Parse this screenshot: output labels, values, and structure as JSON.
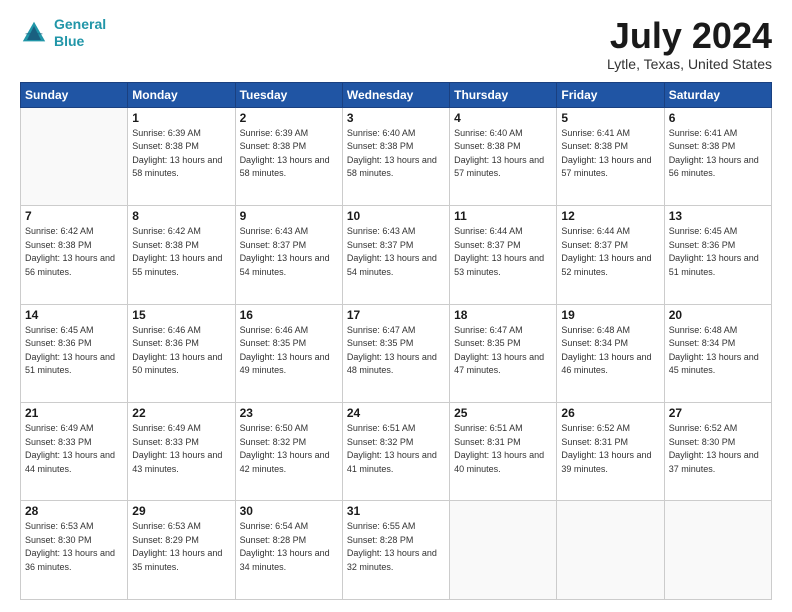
{
  "header": {
    "logo_line1": "General",
    "logo_line2": "Blue",
    "title": "July 2024",
    "location": "Lytle, Texas, United States"
  },
  "days_of_week": [
    "Sunday",
    "Monday",
    "Tuesday",
    "Wednesday",
    "Thursday",
    "Friday",
    "Saturday"
  ],
  "weeks": [
    [
      {
        "day": "",
        "sunrise": "",
        "sunset": "",
        "daylight": ""
      },
      {
        "day": "1",
        "sunrise": "Sunrise: 6:39 AM",
        "sunset": "Sunset: 8:38 PM",
        "daylight": "Daylight: 13 hours and 58 minutes."
      },
      {
        "day": "2",
        "sunrise": "Sunrise: 6:39 AM",
        "sunset": "Sunset: 8:38 PM",
        "daylight": "Daylight: 13 hours and 58 minutes."
      },
      {
        "day": "3",
        "sunrise": "Sunrise: 6:40 AM",
        "sunset": "Sunset: 8:38 PM",
        "daylight": "Daylight: 13 hours and 58 minutes."
      },
      {
        "day": "4",
        "sunrise": "Sunrise: 6:40 AM",
        "sunset": "Sunset: 8:38 PM",
        "daylight": "Daylight: 13 hours and 57 minutes."
      },
      {
        "day": "5",
        "sunrise": "Sunrise: 6:41 AM",
        "sunset": "Sunset: 8:38 PM",
        "daylight": "Daylight: 13 hours and 57 minutes."
      },
      {
        "day": "6",
        "sunrise": "Sunrise: 6:41 AM",
        "sunset": "Sunset: 8:38 PM",
        "daylight": "Daylight: 13 hours and 56 minutes."
      }
    ],
    [
      {
        "day": "7",
        "sunrise": "Sunrise: 6:42 AM",
        "sunset": "Sunset: 8:38 PM",
        "daylight": "Daylight: 13 hours and 56 minutes."
      },
      {
        "day": "8",
        "sunrise": "Sunrise: 6:42 AM",
        "sunset": "Sunset: 8:38 PM",
        "daylight": "Daylight: 13 hours and 55 minutes."
      },
      {
        "day": "9",
        "sunrise": "Sunrise: 6:43 AM",
        "sunset": "Sunset: 8:37 PM",
        "daylight": "Daylight: 13 hours and 54 minutes."
      },
      {
        "day": "10",
        "sunrise": "Sunrise: 6:43 AM",
        "sunset": "Sunset: 8:37 PM",
        "daylight": "Daylight: 13 hours and 54 minutes."
      },
      {
        "day": "11",
        "sunrise": "Sunrise: 6:44 AM",
        "sunset": "Sunset: 8:37 PM",
        "daylight": "Daylight: 13 hours and 53 minutes."
      },
      {
        "day": "12",
        "sunrise": "Sunrise: 6:44 AM",
        "sunset": "Sunset: 8:37 PM",
        "daylight": "Daylight: 13 hours and 52 minutes."
      },
      {
        "day": "13",
        "sunrise": "Sunrise: 6:45 AM",
        "sunset": "Sunset: 8:36 PM",
        "daylight": "Daylight: 13 hours and 51 minutes."
      }
    ],
    [
      {
        "day": "14",
        "sunrise": "Sunrise: 6:45 AM",
        "sunset": "Sunset: 8:36 PM",
        "daylight": "Daylight: 13 hours and 51 minutes."
      },
      {
        "day": "15",
        "sunrise": "Sunrise: 6:46 AM",
        "sunset": "Sunset: 8:36 PM",
        "daylight": "Daylight: 13 hours and 50 minutes."
      },
      {
        "day": "16",
        "sunrise": "Sunrise: 6:46 AM",
        "sunset": "Sunset: 8:35 PM",
        "daylight": "Daylight: 13 hours and 49 minutes."
      },
      {
        "day": "17",
        "sunrise": "Sunrise: 6:47 AM",
        "sunset": "Sunset: 8:35 PM",
        "daylight": "Daylight: 13 hours and 48 minutes."
      },
      {
        "day": "18",
        "sunrise": "Sunrise: 6:47 AM",
        "sunset": "Sunset: 8:35 PM",
        "daylight": "Daylight: 13 hours and 47 minutes."
      },
      {
        "day": "19",
        "sunrise": "Sunrise: 6:48 AM",
        "sunset": "Sunset: 8:34 PM",
        "daylight": "Daylight: 13 hours and 46 minutes."
      },
      {
        "day": "20",
        "sunrise": "Sunrise: 6:48 AM",
        "sunset": "Sunset: 8:34 PM",
        "daylight": "Daylight: 13 hours and 45 minutes."
      }
    ],
    [
      {
        "day": "21",
        "sunrise": "Sunrise: 6:49 AM",
        "sunset": "Sunset: 8:33 PM",
        "daylight": "Daylight: 13 hours and 44 minutes."
      },
      {
        "day": "22",
        "sunrise": "Sunrise: 6:49 AM",
        "sunset": "Sunset: 8:33 PM",
        "daylight": "Daylight: 13 hours and 43 minutes."
      },
      {
        "day": "23",
        "sunrise": "Sunrise: 6:50 AM",
        "sunset": "Sunset: 8:32 PM",
        "daylight": "Daylight: 13 hours and 42 minutes."
      },
      {
        "day": "24",
        "sunrise": "Sunrise: 6:51 AM",
        "sunset": "Sunset: 8:32 PM",
        "daylight": "Daylight: 13 hours and 41 minutes."
      },
      {
        "day": "25",
        "sunrise": "Sunrise: 6:51 AM",
        "sunset": "Sunset: 8:31 PM",
        "daylight": "Daylight: 13 hours and 40 minutes."
      },
      {
        "day": "26",
        "sunrise": "Sunrise: 6:52 AM",
        "sunset": "Sunset: 8:31 PM",
        "daylight": "Daylight: 13 hours and 39 minutes."
      },
      {
        "day": "27",
        "sunrise": "Sunrise: 6:52 AM",
        "sunset": "Sunset: 8:30 PM",
        "daylight": "Daylight: 13 hours and 37 minutes."
      }
    ],
    [
      {
        "day": "28",
        "sunrise": "Sunrise: 6:53 AM",
        "sunset": "Sunset: 8:30 PM",
        "daylight": "Daylight: 13 hours and 36 minutes."
      },
      {
        "day": "29",
        "sunrise": "Sunrise: 6:53 AM",
        "sunset": "Sunset: 8:29 PM",
        "daylight": "Daylight: 13 hours and 35 minutes."
      },
      {
        "day": "30",
        "sunrise": "Sunrise: 6:54 AM",
        "sunset": "Sunset: 8:28 PM",
        "daylight": "Daylight: 13 hours and 34 minutes."
      },
      {
        "day": "31",
        "sunrise": "Sunrise: 6:55 AM",
        "sunset": "Sunset: 8:28 PM",
        "daylight": "Daylight: 13 hours and 32 minutes."
      },
      {
        "day": "",
        "sunrise": "",
        "sunset": "",
        "daylight": ""
      },
      {
        "day": "",
        "sunrise": "",
        "sunset": "",
        "daylight": ""
      },
      {
        "day": "",
        "sunrise": "",
        "sunset": "",
        "daylight": ""
      }
    ]
  ]
}
